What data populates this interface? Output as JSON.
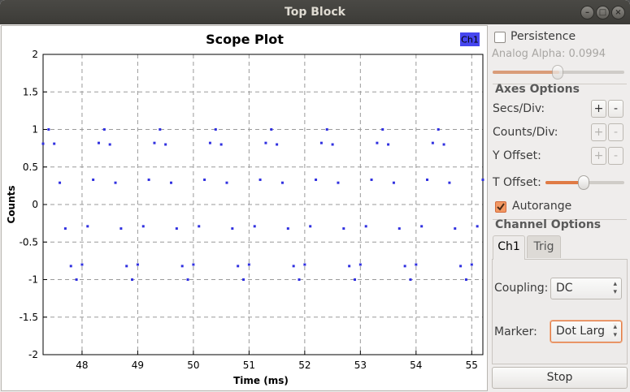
{
  "window": {
    "title": "Top Block"
  },
  "plot": {
    "title": "Scope Plot",
    "legend_label": "Ch1"
  },
  "controls": {
    "persistence_label": "Persistence",
    "persistence_checked": false,
    "analog_alpha_label": "Analog Alpha: 0.0994",
    "analog_alpha_value": 0.0994,
    "axes_header": "Axes Options",
    "secs_div_label": "Secs/Div:",
    "counts_div_label": "Counts/Div:",
    "y_offset_label": "Y Offset:",
    "t_offset_label": "T Offset:",
    "plus": "+",
    "minus": "-",
    "autorange_label": "Autorange",
    "autorange_checked": true,
    "channel_header": "Channel Options",
    "tab_ch1": "Ch1",
    "tab_trig": "Trig",
    "coupling_label": "Coupling:",
    "coupling_value": "DC",
    "marker_label": "Marker:",
    "marker_value": "Dot Larg",
    "stop_label": "Stop"
  },
  "colors": {
    "series": "#3030e0",
    "accent": "#e07b45"
  },
  "chart_data": {
    "type": "scatter",
    "title": "Scope Plot",
    "xlabel": "Time (ms)",
    "ylabel": "Counts",
    "xlim": [
      47.3,
      55.2
    ],
    "ylim": [
      -2,
      2
    ],
    "x_ticks": [
      48,
      49,
      50,
      51,
      52,
      53,
      54,
      55
    ],
    "y_ticks": [
      2,
      1.5,
      1,
      0.5,
      0,
      -0.5,
      -1,
      -1.5,
      -2
    ],
    "grid": true,
    "legend": "top-right",
    "series": [
      {
        "name": "Ch1",
        "x": [
          47.3,
          47.4,
          47.5,
          47.6,
          47.7,
          47.8,
          47.9,
          48.0,
          48.1,
          48.2,
          48.3,
          48.4,
          48.5,
          48.6,
          48.7,
          48.8,
          48.9,
          49.0,
          49.1,
          49.2,
          49.3,
          49.4,
          49.5,
          49.6,
          49.7,
          49.8,
          49.9,
          50.0,
          50.1,
          50.2,
          50.3,
          50.4,
          50.5,
          50.6,
          50.7,
          50.8,
          50.9,
          51.0,
          51.1,
          51.2,
          51.3,
          51.4,
          51.5,
          51.6,
          51.7,
          51.8,
          51.9,
          52.0,
          52.1,
          52.2,
          52.3,
          52.4,
          52.5,
          52.6,
          52.7,
          52.8,
          52.9,
          53.0,
          53.1,
          53.2,
          53.3,
          53.4,
          53.5,
          53.6,
          53.7,
          53.8,
          53.9,
          54.0,
          54.1,
          54.2,
          54.3,
          54.4,
          54.5,
          54.6,
          54.7,
          54.8,
          54.9,
          55.0,
          55.1,
          55.2
        ],
        "values": [
          0.81,
          1.0,
          0.81,
          0.29,
          -0.32,
          -0.82,
          -1.0,
          -0.8,
          -0.29,
          0.33,
          0.82,
          1.0,
          0.8,
          0.29,
          -0.32,
          -0.82,
          -1.0,
          -0.8,
          -0.29,
          0.33,
          0.82,
          1.0,
          0.8,
          0.29,
          -0.32,
          -0.82,
          -1.0,
          -0.8,
          -0.29,
          0.33,
          0.82,
          1.0,
          0.8,
          0.29,
          -0.32,
          -0.82,
          -1.0,
          -0.8,
          -0.29,
          0.33,
          0.82,
          1.0,
          0.8,
          0.29,
          -0.32,
          -0.82,
          -1.0,
          -0.8,
          -0.29,
          0.33,
          0.82,
          1.0,
          0.8,
          0.29,
          -0.32,
          -0.82,
          -1.0,
          -0.8,
          -0.29,
          0.33,
          0.82,
          1.0,
          0.8,
          0.29,
          -0.32,
          -0.82,
          -1.0,
          -0.8,
          -0.29,
          0.33,
          0.82,
          1.0,
          0.8,
          0.29,
          -0.32,
          -0.82,
          -1.0,
          -0.8,
          -0.29,
          0.33
        ]
      }
    ]
  }
}
